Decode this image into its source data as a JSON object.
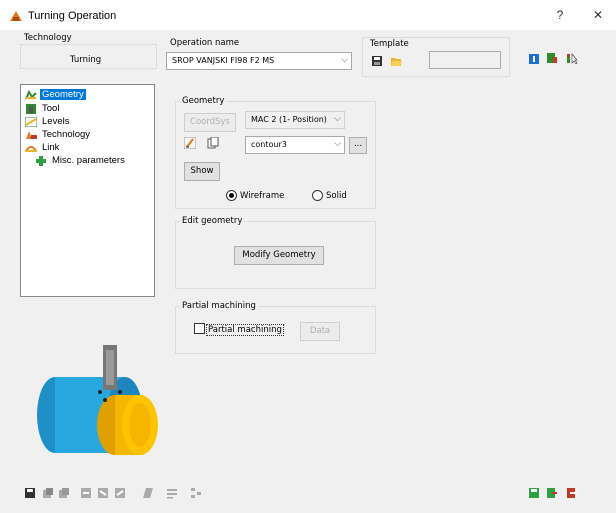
{
  "window": {
    "title": "Turning Operation",
    "help_label": "?",
    "close_label": "✕"
  },
  "technology": {
    "label": "Technology",
    "value": "Turning"
  },
  "operation": {
    "label": "Operation name",
    "value": "SROP VANJSKI FI98 F2 MS"
  },
  "template": {
    "label": "Template",
    "value": ""
  },
  "tree": {
    "items": [
      {
        "label": "Geometry",
        "icon": "geometry-icon",
        "selected": true
      },
      {
        "label": "Tool",
        "icon": "tool-icon"
      },
      {
        "label": "Levels",
        "icon": "levels-icon"
      },
      {
        "label": "Technology",
        "icon": "technology-icon"
      },
      {
        "label": "Link",
        "icon": "link-icon"
      },
      {
        "label": "Misc. parameters",
        "icon": "plus-icon"
      }
    ]
  },
  "geometry_section": {
    "title": "Geometry",
    "coordsys_label": "CoordSys",
    "mac_value": "MAC 2 (1- Position)",
    "contour_value": "contour3",
    "browse_label": "...",
    "show_label": "Show",
    "wireframe_label": "Wireframe",
    "solid_label": "Solid",
    "selected_view": "Wireframe"
  },
  "edit_geometry": {
    "title": "Edit geometry",
    "modify_label": "Modify Geometry"
  },
  "partial_machining": {
    "title": "Partial machining",
    "checkbox_label": "Partial machining",
    "checked": false,
    "data_label": "Data"
  },
  "colors": {
    "accent": "#0078d7",
    "part_body": "#29a8e0",
    "part_face": "#f5b800"
  }
}
